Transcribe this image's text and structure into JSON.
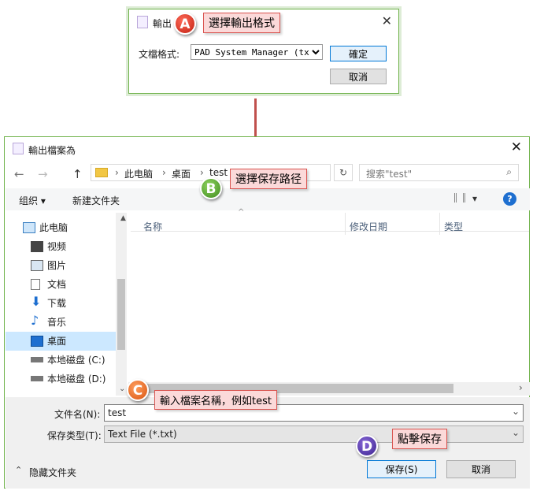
{
  "export_dialog": {
    "title": "輸出",
    "format_label": "文檔格式:",
    "format_value": "PAD System Manager (txt)",
    "ok_label": "確定",
    "cancel_label": "取消",
    "close_glyph": "✕"
  },
  "callouts": {
    "a": {
      "badge": "A",
      "text": "選擇輸出格式"
    },
    "b": {
      "badge": "B",
      "text": "選擇保存路径"
    },
    "c": {
      "badge": "C",
      "text": "輸入檔案名稱，例如test"
    },
    "d": {
      "badge": "D",
      "text": "點擊保存"
    }
  },
  "save_dialog": {
    "title": "輸出檔案為",
    "close_glyph": "✕",
    "nav": {
      "back": "←",
      "forward": "→",
      "up": "↑"
    },
    "breadcrumb": [
      "此电脑",
      "桌面",
      "test"
    ],
    "refresh_glyph": "↻",
    "search_placeholder": "搜索\"test\"",
    "toolbar": {
      "organize": "组织 ▾",
      "new_folder": "新建文件夹",
      "view": "▾"
    },
    "sidebar": [
      {
        "label": "此电脑",
        "icon": "computer-icon"
      },
      {
        "label": "视频",
        "icon": "video-icon"
      },
      {
        "label": "图片",
        "icon": "picture-icon"
      },
      {
        "label": "文档",
        "icon": "document-icon"
      },
      {
        "label": "下载",
        "icon": "download-icon"
      },
      {
        "label": "音乐",
        "icon": "music-icon"
      },
      {
        "label": "桌面",
        "icon": "desktop-icon"
      },
      {
        "label": "本地磁盘 (C:)",
        "icon": "drive-icon"
      },
      {
        "label": "本地磁盘 (D:)",
        "icon": "drive-icon"
      }
    ],
    "columns": {
      "name": "名称",
      "date": "修改日期",
      "type": "类型"
    },
    "filename_label": "文件名(N):",
    "filename_value": "test",
    "filetype_label": "保存类型(T):",
    "filetype_value": "Text File (*.txt)",
    "hide_folders": "隐藏文件夹",
    "save_label": "保存(S)",
    "cancel_label": "取消"
  },
  "colors": {
    "accent": "#0078d7",
    "callout_fill": "#fbd9d9",
    "callout_border": "#d9534f",
    "frame": "#6fb24a",
    "arrow": "#c0504d"
  }
}
